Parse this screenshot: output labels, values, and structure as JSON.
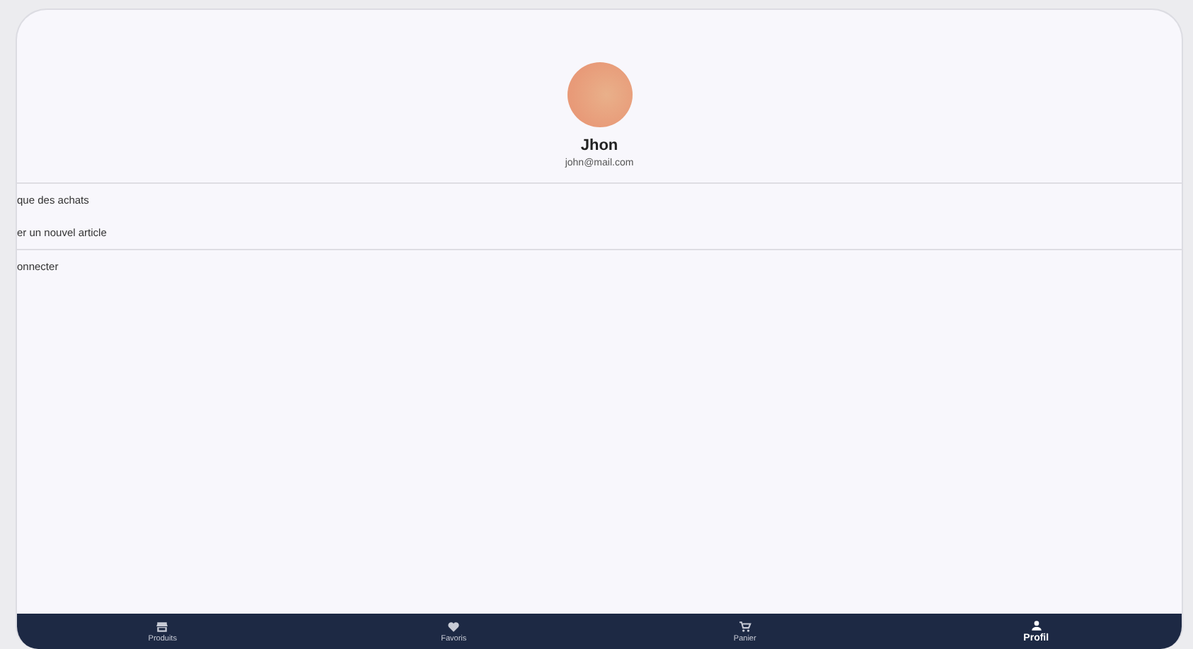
{
  "profile": {
    "name": "Jhon",
    "email": "john@mail.com"
  },
  "menu_sections": [
    [
      {
        "label": "que des achats"
      },
      {
        "label": "er un nouvel article"
      }
    ],
    [
      {
        "label": "onnecter"
      }
    ]
  ],
  "nav": [
    {
      "label": "Produits",
      "selected": false
    },
    {
      "label": "Favoris",
      "selected": false
    },
    {
      "label": "Panier",
      "selected": false
    },
    {
      "label": "Profil",
      "selected": true
    }
  ]
}
